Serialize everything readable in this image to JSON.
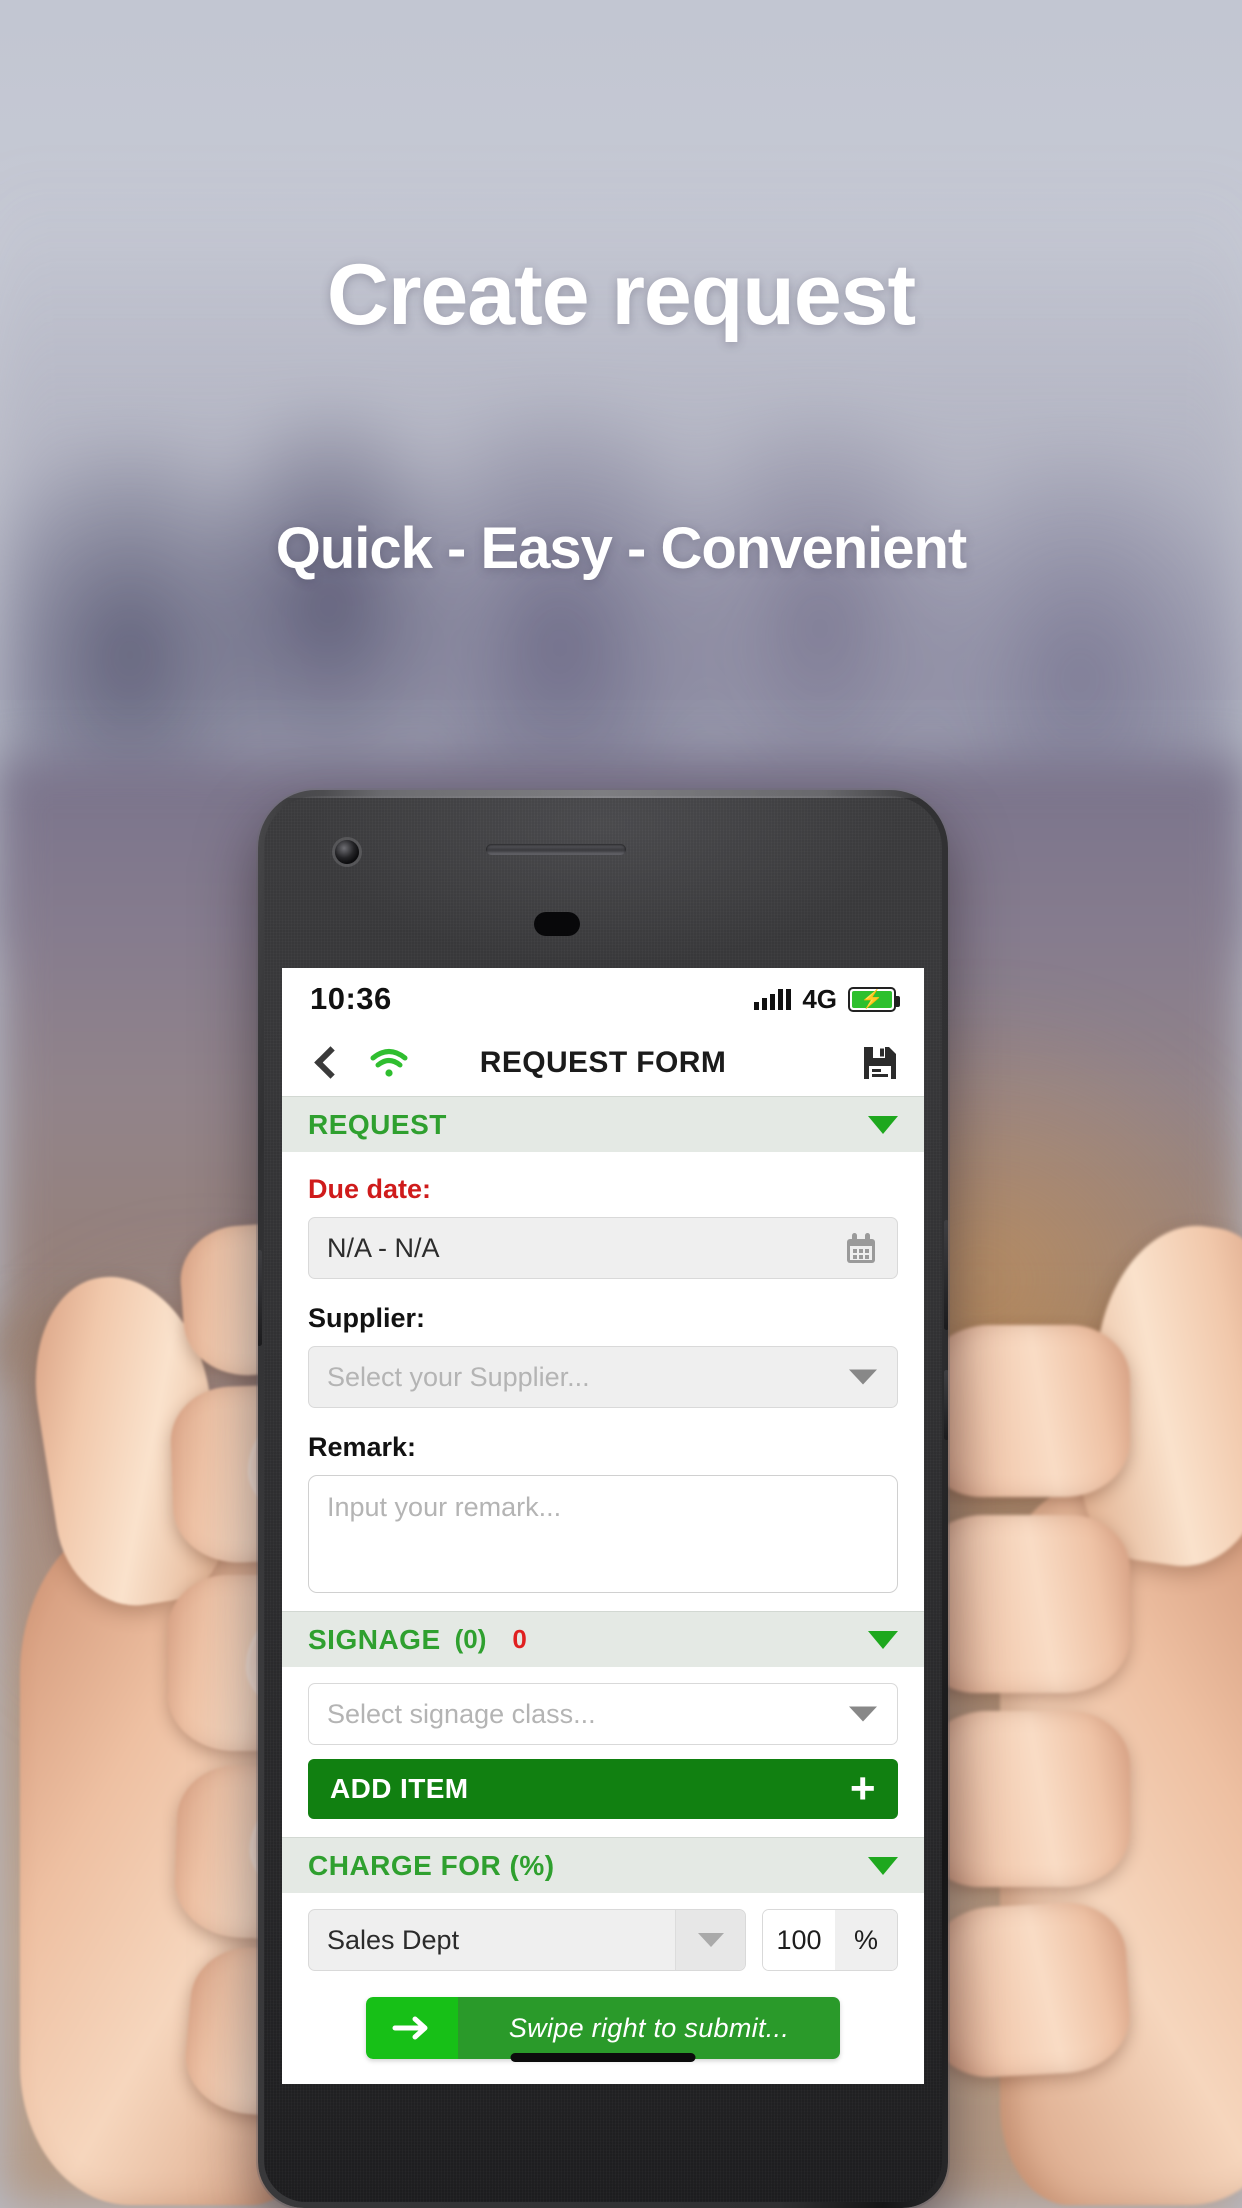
{
  "promo": {
    "title": "Create request",
    "subtitle": "Quick - Easy - Convenient"
  },
  "phone": {
    "status_bar": {
      "time": "10:36",
      "network": "4G",
      "signal_icon": "signal-bars-icon",
      "battery_icon": "battery-charging-icon"
    },
    "app_header": {
      "back_icon": "back-chevron-icon",
      "wifi_icon": "wifi-icon",
      "title": "REQUEST FORM",
      "save_icon": "save-floppy-icon"
    },
    "sections": {
      "request": {
        "title": "REQUEST",
        "caret_icon": "chevron-down-icon",
        "due_date": {
          "label": "Due date:",
          "value": "N/A - N/A",
          "icon": "calendar-icon"
        },
        "supplier": {
          "label": "Supplier:",
          "placeholder": "Select your Supplier...",
          "value": "",
          "icon": "chevron-down-icon"
        },
        "remark": {
          "label": "Remark:",
          "placeholder": "Input your remark...",
          "value": ""
        }
      },
      "signage": {
        "title": "SIGNAGE",
        "count": "(0)",
        "badge": "0",
        "caret_icon": "chevron-down-icon",
        "class_select": {
          "placeholder": "Select signage class...",
          "value": "",
          "icon": "chevron-down-icon"
        },
        "add_item_label": "ADD ITEM",
        "add_item_icon": "plus-icon"
      },
      "charge_for": {
        "title": "CHARGE FOR (%)",
        "caret_icon": "chevron-down-icon",
        "department": "Sales Dept",
        "department_icon": "chevron-down-icon",
        "percent_value": "100",
        "percent_unit": "%"
      }
    },
    "submit": {
      "label": "Swipe right to submit...",
      "arrow_icon": "arrow-right-icon"
    },
    "home_indicator": "home-indicator"
  },
  "colors": {
    "accent_green": "#2fa02f",
    "button_green": "#118011",
    "swipe_thumb_green": "#17c017",
    "swipe_track_green": "#2a9a2a",
    "danger_red": "#cf1b1b",
    "section_bar": "#e4e9e4"
  }
}
